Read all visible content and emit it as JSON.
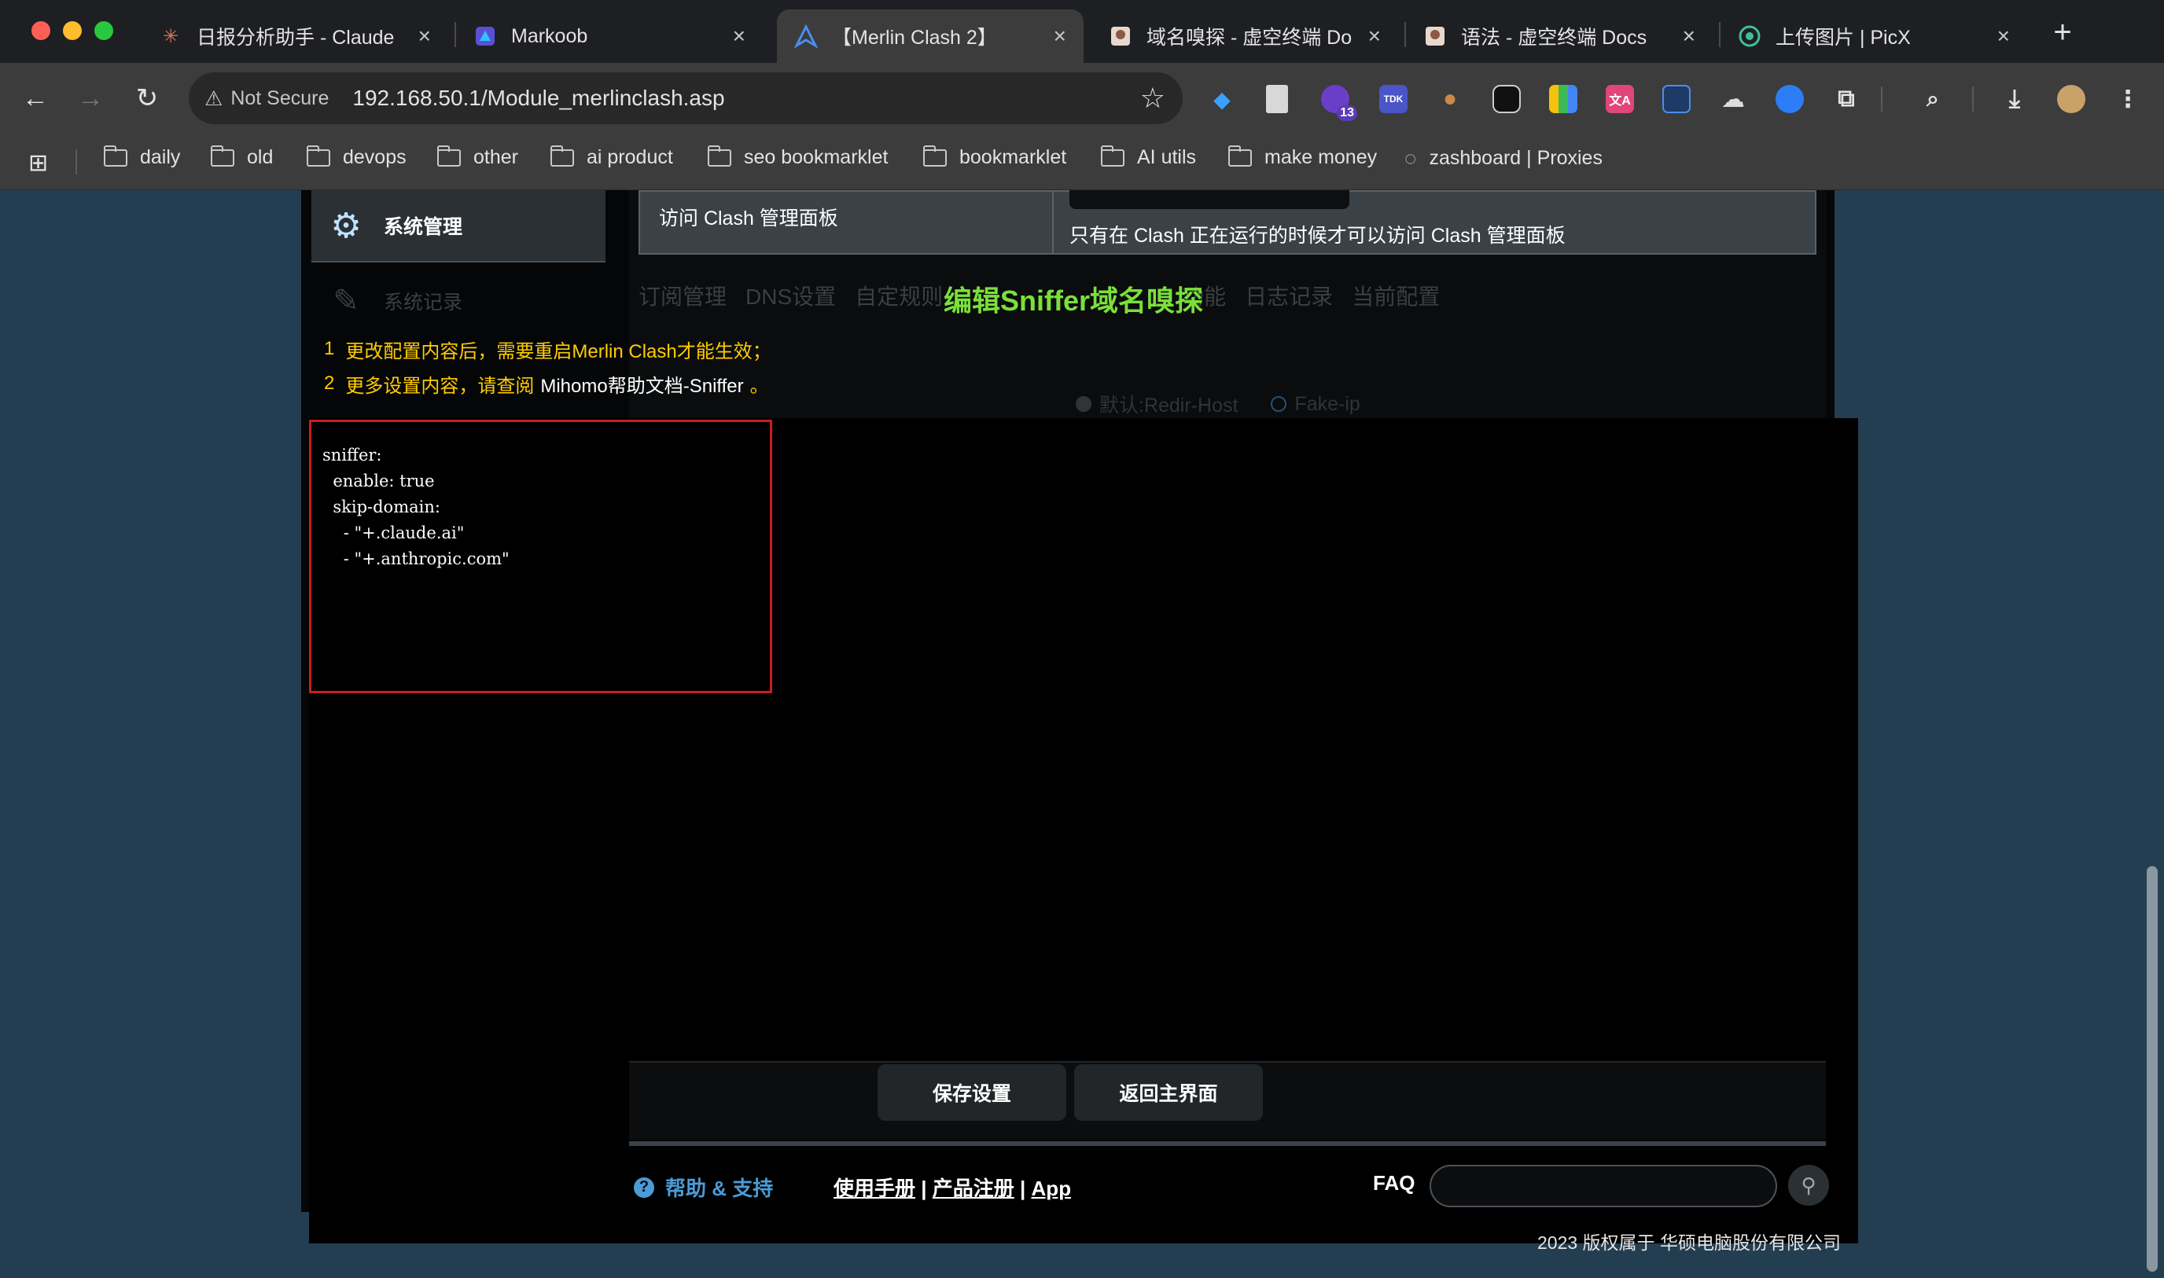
{
  "browser": {
    "tabs": [
      {
        "title": "日报分析助手 - Claude",
        "icon": "claude-icon"
      },
      {
        "title": "Markoob",
        "icon": "markoob-icon"
      },
      {
        "title": "【Merlin Clash 2】",
        "icon": "merlin-icon",
        "active": true
      },
      {
        "title": "域名嗅探 - 虚空终端 Do",
        "icon": "docs-icon"
      },
      {
        "title": "语法 - 虚空终端 Docs",
        "icon": "docs-icon"
      },
      {
        "title": "上传图片 | PicX",
        "icon": "picx-icon"
      }
    ],
    "close_glyph": "×",
    "new_tab_glyph": "+",
    "security_label": "Not Secure",
    "url": "192.168.50.1/Module_merlinclash.asp",
    "extension_badge": "13",
    "ext_tdk_label": "TDK",
    "bookmarks": [
      "daily",
      "old",
      "devops",
      "other",
      "ai product",
      "seo bookmarklet",
      "bookmarklet",
      "AI utils",
      "make money",
      "zashboard | Proxies"
    ]
  },
  "router": {
    "menu_sysadmin": "系统管理",
    "menu_syslog": "系统记录",
    "dash_row_label": "访问 Clash 管理面板",
    "dash_hint": "只有在 Clash 正在运行的时候才可以访问 Clash 管理面板",
    "tabs": [
      "订阅管理",
      "DNS设置",
      "自定规则",
      "",
      "功能",
      "日志记录",
      "当前配置"
    ],
    "radio_default": "默认:Redir-Host",
    "radio_fakeip": "Fake-ip"
  },
  "sniffer": {
    "title": "编辑Sniffer域名嗅探",
    "note1_num": "1",
    "note1_text": "更改配置内容后，需要重启Merlin Clash才能生效；",
    "note2_num": "2",
    "note2_text_a": "更多设置内容，请查阅",
    "note2_link": "Mihomo帮助文档-Sniffer",
    "note2_text_b": "。",
    "config_lines": [
      "sniffer:",
      "  enable: true",
      "  skip-domain:",
      "    - \"+.claude.ai\"",
      "    - \"+.anthropic.com\""
    ]
  },
  "buttons": {
    "save": "保存设置",
    "back": "返回主界面"
  },
  "footer": {
    "help": "帮助 & 支持",
    "link_manual": "使用手册",
    "link_register": "产品注册",
    "link_app": "App",
    "separator": "|",
    "faq": "FAQ",
    "copyright": "2023 版权属于 华硕电脑股份有限公司"
  },
  "colors": {
    "accent_green": "#7ae03a",
    "note_yellow": "#ffcc00",
    "editor_border": "#c81e1e",
    "help_blue": "#4b9bd6"
  }
}
